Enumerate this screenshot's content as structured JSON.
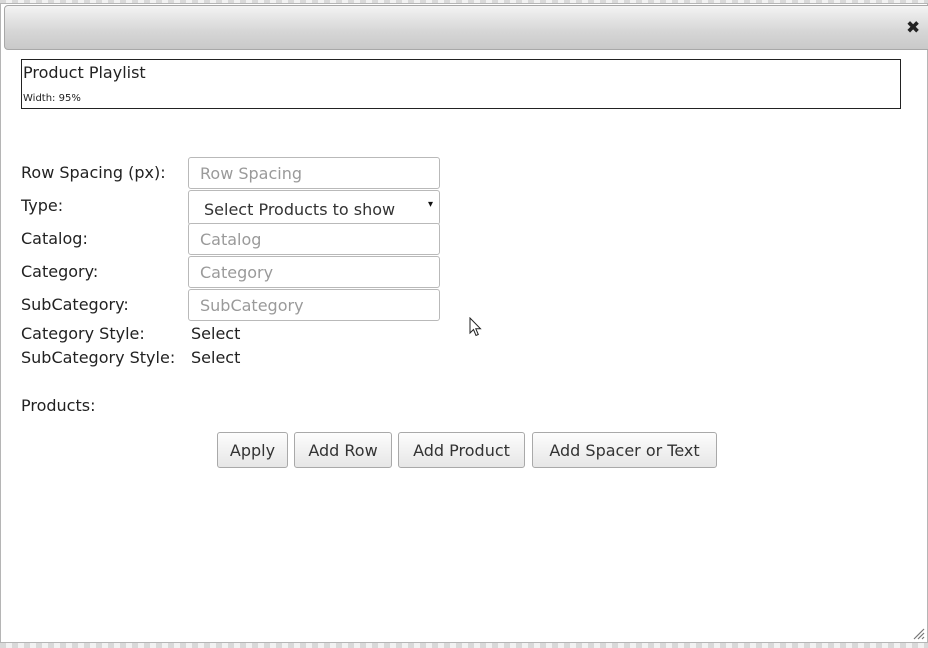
{
  "dialog": {
    "close_glyph": "✖"
  },
  "header": {
    "title": "Product Playlist",
    "width_note": "Width: 95%"
  },
  "form": {
    "row_spacing": {
      "label": "Row Spacing (px):",
      "placeholder": "Row Spacing"
    },
    "type": {
      "label": "Type:",
      "selected": "Select Products to show",
      "arrow": "▾"
    },
    "catalog": {
      "label": "Catalog:",
      "placeholder": "Catalog"
    },
    "category": {
      "label": "Category:",
      "placeholder": "Category"
    },
    "subcategory": {
      "label": "SubCategory:",
      "placeholder": "SubCategory"
    },
    "category_style": {
      "label": "Category Style:",
      "value": "Select"
    },
    "subcategory_style": {
      "label": "SubCategory Style:",
      "value": "Select"
    },
    "products": {
      "label": "Products:"
    }
  },
  "buttons": {
    "apply": "Apply",
    "add_row": "Add Row",
    "add_product": "Add Product",
    "add_spacer": "Add Spacer or Text"
  },
  "icons": {
    "close": "close-icon",
    "cursor": "mouse-cursor-icon",
    "resize": "resize-grip-icon"
  }
}
